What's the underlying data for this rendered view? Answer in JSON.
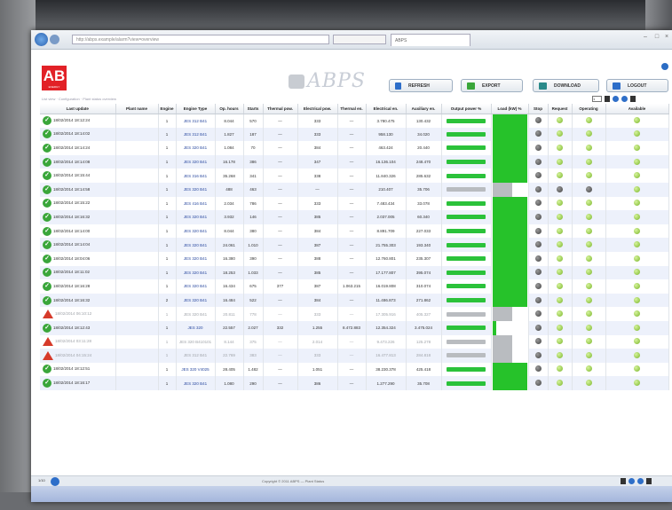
{
  "browser": {
    "address": "http://abps.example/alarm?view=overview",
    "search": "",
    "tab": "ABPS"
  },
  "app": {
    "logo": "AB",
    "logo_sub": "ENERGY",
    "brand": "ABPS",
    "subtitle": "List view · Configuration · Plant status overview",
    "buttons": {
      "refresh": "REFRESH",
      "export": "EXPORT",
      "download": "DOWNLOAD",
      "logout": "LOGOUT"
    },
    "page_box": "1"
  },
  "table": {
    "columns": [
      "Last update",
      "Plant name",
      "Engine",
      "Engine Type",
      "Op. hours",
      "Starts",
      "Thermal pow.",
      "Electrical pow.",
      "Thermal en.",
      "Electrical en.",
      "Auxiliary en.",
      "Output power %",
      "Load (kW) %",
      "Stop",
      "Request",
      "Operating",
      "Available"
    ],
    "rows": [
      {
        "status": "ok",
        "date": "18/02/2014 18:12:24",
        "plant": "",
        "engine": "1",
        "type": "JES 312 B41",
        "hours": "8.044",
        "starts": "570",
        "thermal": "—",
        "elec": "333",
        "thermal_en": "—",
        "elec_en": "3.780.475",
        "aux": "130.432",
        "output": "green",
        "load": 96,
        "stop": "dark",
        "req": "green",
        "op": "green",
        "avail": "green",
        "dim": false
      },
      {
        "status": "ok",
        "date": "18/02/2014 18:14:02",
        "plant": "",
        "engine": "1",
        "type": "JES 312 B41",
        "hours": "1.827",
        "starts": "187",
        "thermal": "—",
        "elec": "333",
        "thermal_en": "—",
        "elec_en": "958.130",
        "aux": "34.020",
        "output": "green",
        "load": 96,
        "stop": "dark",
        "req": "green",
        "op": "green",
        "avail": "green",
        "dim": false
      },
      {
        "status": "ok",
        "date": "18/02/2014 18:14:24",
        "plant": "",
        "engine": "1",
        "type": "JES 320 B41",
        "hours": "1.084",
        "starts": "70",
        "thermal": "—",
        "elec": "384",
        "thermal_en": "—",
        "elec_en": "463.424",
        "aux": "20.440",
        "output": "green",
        "load": 96,
        "stop": "dark",
        "req": "green",
        "op": "green",
        "avail": "green",
        "dim": false
      },
      {
        "status": "ok",
        "date": "18/02/2014 18:14:08",
        "plant": "",
        "engine": "1",
        "type": "JES 320 B41",
        "hours": "16.178",
        "starts": "386",
        "thermal": "—",
        "elec": "347",
        "thermal_en": "—",
        "elec_en": "16.136.104",
        "aux": "248.470",
        "output": "green",
        "load": 96,
        "stop": "dark",
        "req": "green",
        "op": "green",
        "avail": "green",
        "dim": false
      },
      {
        "status": "ok",
        "date": "18/02/2014 18:15:44",
        "plant": "",
        "engine": "1",
        "type": "JES 316 B41",
        "hours": "35.268",
        "starts": "341",
        "thermal": "—",
        "elec": "338",
        "thermal_en": "—",
        "elec_en": "11.840.326",
        "aux": "285.632",
        "output": "green",
        "load": 96,
        "stop": "dark",
        "req": "green",
        "op": "green",
        "avail": "green",
        "dim": false
      },
      {
        "status": "ok",
        "date": "18/02/2014 18:14:58",
        "plant": "",
        "engine": "1",
        "type": "JES 320 B41",
        "hours": "488",
        "starts": "463",
        "thermal": "—",
        "elec": "—",
        "thermal_en": "—",
        "elec_en": "210.407",
        "aux": "35.706",
        "output": "gray",
        "load": 0,
        "stop": "dark",
        "req": "dark",
        "op": "dark",
        "avail": "green",
        "dim": false
      },
      {
        "status": "ok",
        "date": "18/02/2014 18:15:22",
        "plant": "",
        "engine": "1",
        "type": "JES 416 B41",
        "hours": "2.034",
        "starts": "786",
        "thermal": "—",
        "elec": "333",
        "thermal_en": "—",
        "elec_en": "7.483.434",
        "aux": "33.078",
        "output": "green",
        "load": 96,
        "stop": "dark",
        "req": "green",
        "op": "green",
        "avail": "green",
        "dim": false
      },
      {
        "status": "ok",
        "date": "18/02/2014 18:16:32",
        "plant": "",
        "engine": "1",
        "type": "JES 320 B41",
        "hours": "3.932",
        "starts": "146",
        "thermal": "—",
        "elec": "385",
        "thermal_en": "—",
        "elec_en": "2.037.005",
        "aux": "60.340",
        "output": "green",
        "load": 96,
        "stop": "dark",
        "req": "green",
        "op": "green",
        "avail": "green",
        "dim": false
      },
      {
        "status": "ok",
        "date": "18/02/2014 18:14:00",
        "plant": "",
        "engine": "1",
        "type": "JES 320 B41",
        "hours": "8.044",
        "starts": "380",
        "thermal": "—",
        "elec": "384",
        "thermal_en": "—",
        "elec_en": "8.891.709",
        "aux": "227.033",
        "output": "green",
        "load": 96,
        "stop": "dark",
        "req": "green",
        "op": "green",
        "avail": "green",
        "dim": false
      },
      {
        "status": "ok",
        "date": "18/02/2014 18:14:04",
        "plant": "",
        "engine": "1",
        "type": "JES 320 B41",
        "hours": "24.061",
        "starts": "1.010",
        "thermal": "—",
        "elec": "387",
        "thermal_en": "—",
        "elec_en": "21.755.303",
        "aux": "193.340",
        "output": "green",
        "load": 96,
        "stop": "dark",
        "req": "green",
        "op": "green",
        "avail": "green",
        "dim": false
      },
      {
        "status": "ok",
        "date": "18/02/2014 18:04:06",
        "plant": "",
        "engine": "1",
        "type": "JES 320 B41",
        "hours": "16.380",
        "starts": "390",
        "thermal": "—",
        "elec": "388",
        "thermal_en": "—",
        "elec_en": "12.760.801",
        "aux": "235.307",
        "output": "green",
        "load": 96,
        "stop": "dark",
        "req": "green",
        "op": "green",
        "avail": "green",
        "dim": false
      },
      {
        "status": "ok",
        "date": "18/02/2014 18:11:02",
        "plant": "",
        "engine": "1",
        "type": "JES 320 B41",
        "hours": "18.253",
        "starts": "1.033",
        "thermal": "—",
        "elec": "385",
        "thermal_en": "—",
        "elec_en": "17.177.807",
        "aux": "395.074",
        "output": "green",
        "load": 96,
        "stop": "dark",
        "req": "green",
        "op": "green",
        "avail": "green",
        "dim": false
      },
      {
        "status": "ok",
        "date": "18/02/2014 18:16:28",
        "plant": "",
        "engine": "1",
        "type": "JES 320 B41",
        "hours": "16.434",
        "starts": "675",
        "thermal": "377",
        "elec": "387",
        "thermal_en": "1.063.215",
        "elec_en": "16.019.808",
        "aux": "310.074",
        "output": "green",
        "load": 96,
        "stop": "dark",
        "req": "green",
        "op": "green",
        "avail": "green",
        "dim": false
      },
      {
        "status": "ok",
        "date": "18/02/2014 18:16:32",
        "plant": "",
        "engine": "2",
        "type": "JES 320 B41",
        "hours": "16.484",
        "starts": "522",
        "thermal": "—",
        "elec": "384",
        "thermal_en": "—",
        "elec_en": "11.486.873",
        "aux": "271.862",
        "output": "green",
        "load": 96,
        "stop": "dark",
        "req": "green",
        "op": "green",
        "avail": "green",
        "dim": false
      },
      {
        "status": "warn",
        "date": "18/02/2014 06:10:12",
        "plant": "",
        "engine": "1",
        "type": "JES 320 B41",
        "hours": "20.811",
        "starts": "778",
        "thermal": "—",
        "elec": "333",
        "thermal_en": "—",
        "elec_en": "17.305.916",
        "aux": "405.327",
        "output": "gray",
        "load": 0,
        "stop": "dark",
        "req": "green",
        "op": "green",
        "avail": "green",
        "dim": true
      },
      {
        "status": "ok",
        "date": "18/02/2014 18:12:43",
        "plant": "",
        "engine": "1",
        "type": "JES 320",
        "hours": "22.557",
        "starts": "2.027",
        "thermal": "332",
        "elec": "1.255",
        "thermal_en": "8.472.883",
        "elec_en": "12.354.324",
        "aux": "3.475.024",
        "output": "green",
        "load": 12,
        "stop": "dark",
        "req": "green",
        "op": "green",
        "avail": "green",
        "dim": false
      },
      {
        "status": "warn",
        "date": "18/02/2014 03:11:28",
        "plant": "",
        "engine": "1",
        "type": "JES 320 B410101",
        "hours": "8.144",
        "starts": "375",
        "thermal": "—",
        "elec": "2.014",
        "thermal_en": "—",
        "elec_en": "9.473.226",
        "aux": "125.278",
        "output": "gray",
        "load": 0,
        "stop": "dark",
        "req": "green",
        "op": "green",
        "avail": "green",
        "dim": true
      },
      {
        "status": "warn",
        "date": "18/02/2014 04:15:24",
        "plant": "",
        "engine": "1",
        "type": "JES 312 B41",
        "hours": "22.769",
        "starts": "383",
        "thermal": "—",
        "elec": "333",
        "thermal_en": "—",
        "elec_en": "16.477.813",
        "aux": "284.818",
        "output": "gray",
        "load": 0,
        "stop": "dark",
        "req": "green",
        "op": "green",
        "avail": "green",
        "dim": true
      },
      {
        "status": "ok",
        "date": "18/02/2014 18:12:51",
        "plant": "",
        "engine": "1",
        "type": "JES 320 V4025",
        "hours": "28.405",
        "starts": "1.482",
        "thermal": "—",
        "elec": "1.051",
        "thermal_en": "—",
        "elec_en": "38.230.378",
        "aux": "425.418",
        "output": "green",
        "load": 96,
        "stop": "dark",
        "req": "green",
        "op": "green",
        "avail": "green",
        "dim": false
      },
      {
        "status": "ok",
        "date": "18/02/2014 18:16:17",
        "plant": "",
        "engine": "1",
        "type": "JES 320 B41",
        "hours": "1.080",
        "starts": "290",
        "thermal": "—",
        "elec": "386",
        "thermal_en": "—",
        "elec_en": "1.277.290",
        "aux": "35.708",
        "output": "green",
        "load": 96,
        "stop": "dark",
        "req": "green",
        "op": "green",
        "avail": "green",
        "dim": false
      }
    ]
  },
  "footer": {
    "page_info": "1/10",
    "copyright": "Copyright © 2011 ABPS — Plant Status"
  },
  "colors": {
    "brand_red": "#e22127",
    "load_green": "#26c22a",
    "warn_red": "#d63a2a"
  }
}
